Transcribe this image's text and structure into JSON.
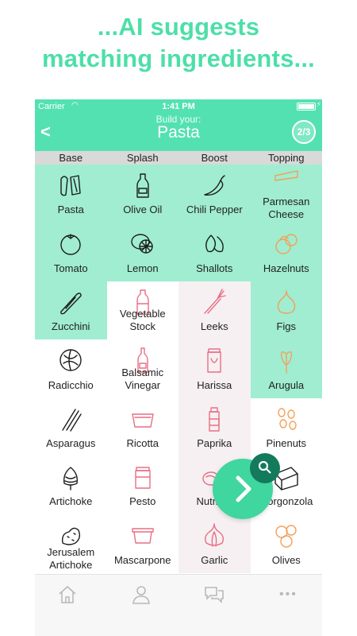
{
  "headline": {
    "line1": "...AI suggests",
    "line2": "matching ingredients..."
  },
  "status": {
    "carrier": "Carrier",
    "time": "1:41 PM"
  },
  "nav": {
    "back": "<",
    "subtitle": "Build your:",
    "title": "Pasta",
    "step": "2/3"
  },
  "columns": [
    "Base",
    "Splash",
    "Boost",
    "Topping"
  ],
  "grid": {
    "base": [
      "Pasta",
      "Tomato",
      "Zucchini",
      "Radicchio",
      "Asparagus",
      "Artichoke",
      "Jerusalem\nArtichoke"
    ],
    "splash": [
      "Olive Oil",
      "Lemon",
      "Vegetable\nStock",
      "Balsamic\nVinegar",
      "Ricotta",
      "Pesto",
      "Mascarpone"
    ],
    "boost": [
      "Chili Pepper",
      "Shallots",
      "Leeks",
      "Harissa",
      "Paprika",
      "Nutmeg",
      "Garlic"
    ],
    "topping": [
      "Parmesan\nCheese",
      "Hazelnuts",
      "Figs",
      "Arugula",
      "Pinenuts",
      "Gorgonzola",
      "Olives"
    ]
  },
  "colors": {
    "accent": "#54e1b1",
    "selected_bg": "#a0edd2",
    "pink_icon": "#e86f84",
    "orange_icon": "#f2a057"
  },
  "tabbar": {
    "icons": [
      "home-icon",
      "profile-icon",
      "chat-icon",
      "more-icon"
    ],
    "more": "•••"
  }
}
